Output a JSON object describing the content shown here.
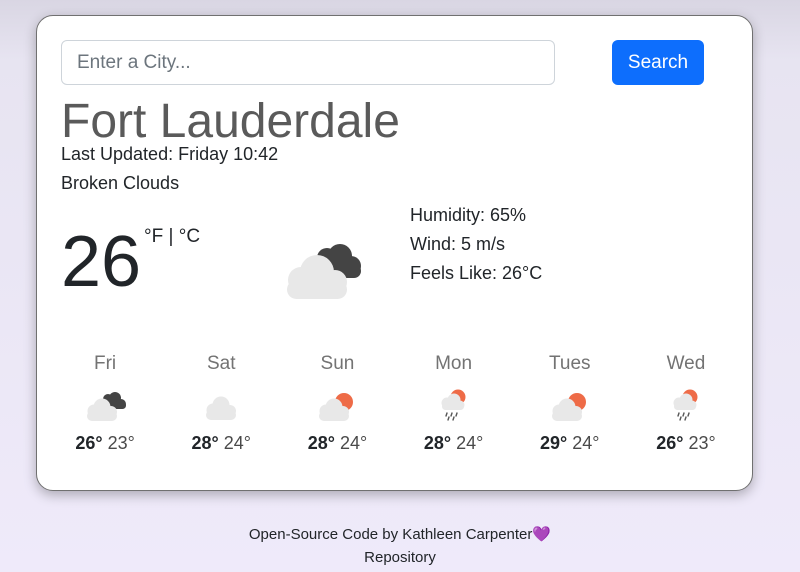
{
  "search": {
    "placeholder": "Enter a City...",
    "value": "",
    "button_label": "Search"
  },
  "current": {
    "city": "Fort Lauderdale",
    "last_updated": "Last Updated: Friday 10:42",
    "description": "Broken Clouds",
    "temperature": "26",
    "unit_f": "°F",
    "unit_separator": " | ",
    "unit_c": "°C",
    "icon": "broken-clouds-icon",
    "humidity": "Humidity: 65%",
    "wind": "Wind: 5 m/s",
    "feels_like": "Feels Like: 26°C"
  },
  "forecast": [
    {
      "day": "Fri",
      "max": "26°",
      "min": "23°",
      "icon": "broken-clouds-icon"
    },
    {
      "day": "Sat",
      "max": "28°",
      "min": "24°",
      "icon": "cloud-icon"
    },
    {
      "day": "Sun",
      "max": "28°",
      "min": "24°",
      "icon": "sun-behind-cloud-icon"
    },
    {
      "day": "Mon",
      "max": "28°",
      "min": "24°",
      "icon": "sun-rain-icon"
    },
    {
      "day": "Tues",
      "max": "29°",
      "min": "24°",
      "icon": "sun-behind-cloud-icon"
    },
    {
      "day": "Wed",
      "max": "26°",
      "min": "23°",
      "icon": "sun-rain-icon"
    }
  ],
  "footer": {
    "credit": "Open-Source Code by Kathleen Carpenter",
    "heart": "💜",
    "repo_link": "Repository"
  },
  "colors": {
    "accent": "#0d6efd",
    "sun": "#ee6b47",
    "dark_cloud": "#444444",
    "light_cloud": "#e8e8e8"
  }
}
